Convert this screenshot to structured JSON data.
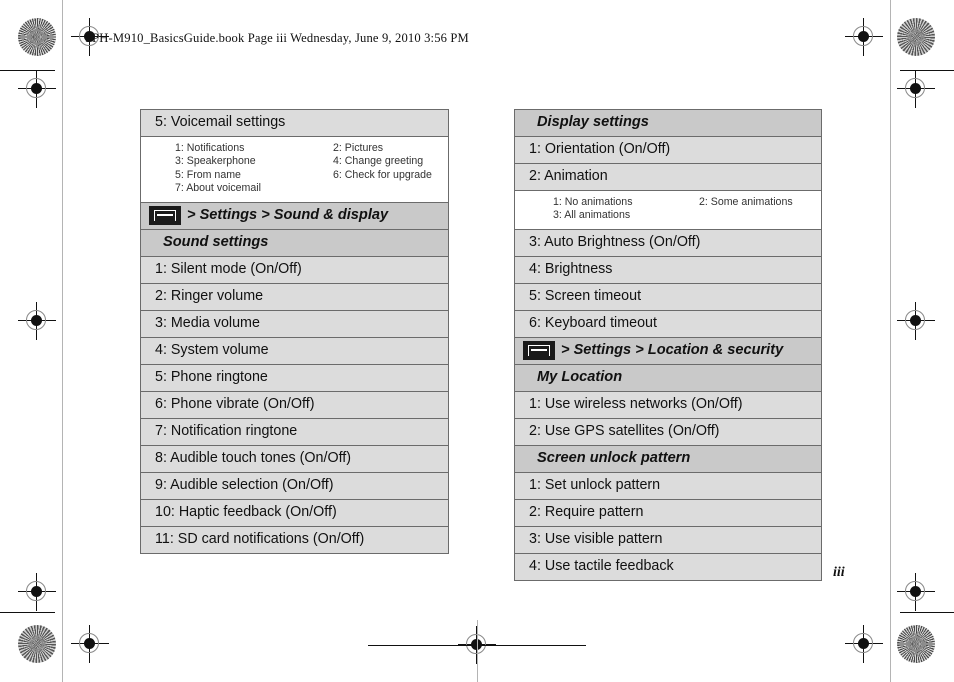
{
  "page": {
    "book_header": "SPH-M910_BasicsGuide.book  Page iii  Wednesday, June 9, 2010  3:56 PM",
    "folio": "iii"
  },
  "left_column": {
    "rows": [
      {
        "kind": "head_plain",
        "label": "5: Voicemail settings"
      },
      {
        "kind": "sub",
        "items": [
          "1: Notifications",
          "2: Pictures",
          "3: Speakerphone",
          "4: Change greeting",
          "5: From name",
          "6: Check for upgrade",
          "7: About voicemail",
          ""
        ]
      },
      {
        "kind": "menu",
        "icon": "menu-key-icon",
        "label": "> Settings > Sound & display"
      },
      {
        "kind": "head",
        "label": "Sound settings"
      },
      {
        "kind": "item",
        "label": "1: Silent mode (On/Off)"
      },
      {
        "kind": "item",
        "label": "2: Ringer volume"
      },
      {
        "kind": "item",
        "label": "3: Media volume"
      },
      {
        "kind": "item",
        "label": "4: System volume"
      },
      {
        "kind": "item",
        "label": "5: Phone ringtone"
      },
      {
        "kind": "item",
        "label": "6: Phone vibrate (On/Off)"
      },
      {
        "kind": "item",
        "label": "7: Notification ringtone"
      },
      {
        "kind": "item",
        "label": "8: Audible touch tones (On/Off)"
      },
      {
        "kind": "item",
        "label": "9: Audible selection (On/Off)"
      },
      {
        "kind": "item",
        "label": "10: Haptic feedback (On/Off)"
      },
      {
        "kind": "item",
        "label": "11: SD card notifications (On/Off)"
      }
    ]
  },
  "right_column": {
    "rows": [
      {
        "kind": "head",
        "label": "Display settings"
      },
      {
        "kind": "item",
        "label": "1: Orientation (On/Off)"
      },
      {
        "kind": "item",
        "label": "2: Animation"
      },
      {
        "kind": "sub",
        "items": [
          "1: No animations",
          "2: Some animations",
          "3: All animations",
          ""
        ]
      },
      {
        "kind": "item",
        "label": "3: Auto Brightness (On/Off)"
      },
      {
        "kind": "item",
        "label": "4: Brightness"
      },
      {
        "kind": "item",
        "label": "5: Screen timeout"
      },
      {
        "kind": "item",
        "label": "6: Keyboard timeout"
      },
      {
        "kind": "menu",
        "icon": "menu-key-icon",
        "label": "> Settings > Location & security"
      },
      {
        "kind": "head",
        "label": "My Location"
      },
      {
        "kind": "item",
        "label": "1: Use wireless networks (On/Off)"
      },
      {
        "kind": "item",
        "label": "2: Use GPS satellites (On/Off)"
      },
      {
        "kind": "head",
        "label": "Screen unlock pattern"
      },
      {
        "kind": "item",
        "label": "1: Set unlock pattern"
      },
      {
        "kind": "item",
        "label": "2: Require pattern"
      },
      {
        "kind": "item",
        "label": "3: Use visible pattern"
      },
      {
        "kind": "item",
        "label": "4: Use tactile feedback"
      }
    ]
  },
  "colors": {
    "row_fill": "#dcdcdc",
    "header_fill": "#c9c9c9",
    "sub_fill": "#ffffff",
    "border": "#6b6b6b",
    "icon_fill": "#1a1a1a"
  }
}
